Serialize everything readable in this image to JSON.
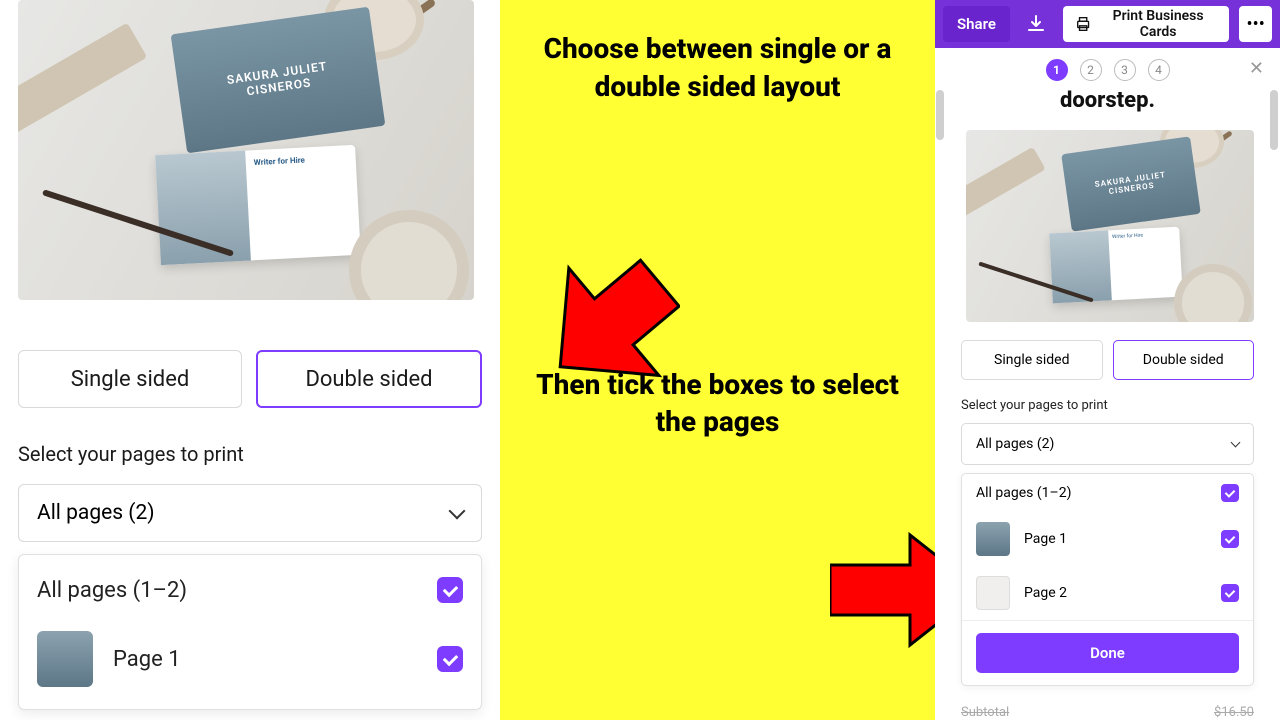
{
  "topbar": {
    "share": "Share",
    "print_btn": "Print Business Cards"
  },
  "steps": {
    "s1": "1",
    "s2": "2",
    "s3": "3",
    "s4": "4"
  },
  "doorstep": "doorstep.",
  "card_name": "SAKURA JULIET",
  "card_surname": "CISNEROS",
  "card_role": "Writer for Hire",
  "left": {
    "single": "Single sided",
    "double": "Double sided",
    "select_label": "Select your pages to print",
    "dropdown": "All pages (2)",
    "all_pages": "All pages (1–2)",
    "page1": "Page 1"
  },
  "right": {
    "single": "Single sided",
    "double": "Double sided",
    "select_label": "Select your pages to print",
    "dropdown": "All pages (2)",
    "all_pages": "All pages (1–2)",
    "page1": "Page 1",
    "page2": "Page 2",
    "done": "Done",
    "subtotal_label": "Subtotal",
    "subtotal_value": "$16.50"
  },
  "instructions": {
    "line1": "Choose between single or a double sided layout",
    "line2": "Then tick the boxes to select the pages"
  }
}
